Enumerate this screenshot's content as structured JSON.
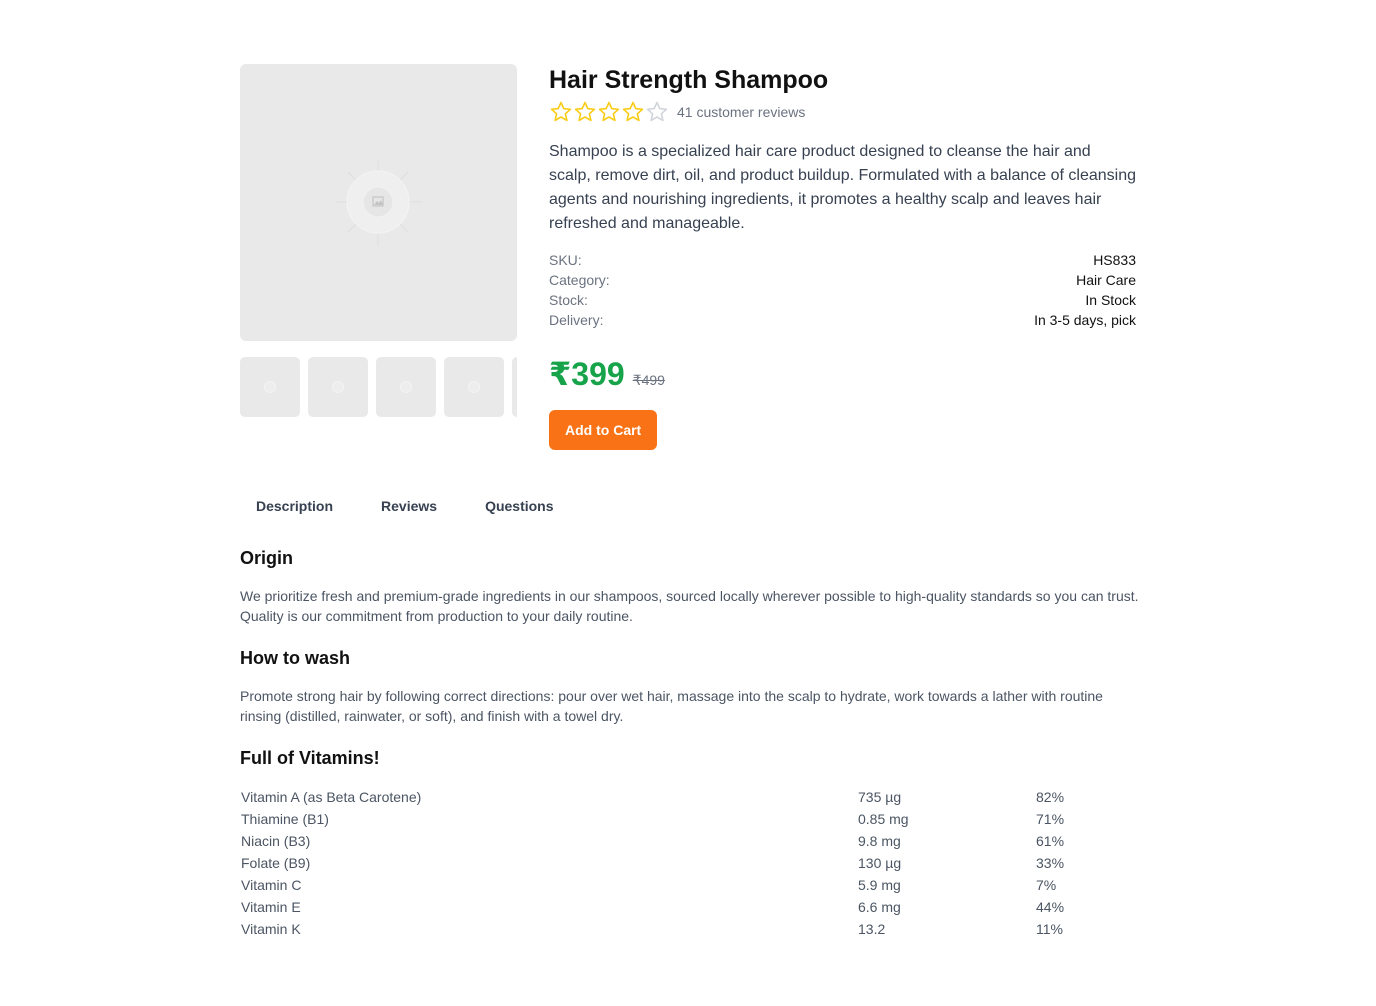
{
  "product": {
    "title": "Hair Strength Shampoo",
    "rating": 4,
    "rating_max": 5,
    "reviews_text": "41 customer reviews",
    "description": "Shampoo is a specialized hair care product designed to cleanse the hair and scalp, remove dirt, oil, and product buildup. Formulated with a balance of cleansing agents and nourishing ingredients, it promotes a healthy scalp and leaves hair refreshed and manageable.",
    "meta": [
      {
        "label": "SKU:",
        "value": "HS833"
      },
      {
        "label": "Category:",
        "value": "Hair Care"
      },
      {
        "label": "Stock:",
        "value": "In Stock"
      },
      {
        "label": "Delivery:",
        "value": "In 3-5 days, pick"
      }
    ],
    "price": "₹399",
    "old_price": "₹499",
    "add_to_cart_label": "Add to Cart"
  },
  "tabs": [
    {
      "label": "Description"
    },
    {
      "label": "Reviews"
    },
    {
      "label": "Questions"
    }
  ],
  "sections": {
    "origin": {
      "title": "Origin",
      "text": "We prioritize fresh and premium-grade ingredients in our shampoos, sourced locally wherever possible to high-quality standards so you can trust. Quality is our commitment from production to your daily routine."
    },
    "how_to_wash": {
      "title": "How to wash",
      "text": "Promote strong hair by following correct directions: pour over wet hair, massage into the scalp to hydrate, work towards a lather with routine rinsing (distilled, rainwater, or soft), and finish with a towel dry."
    },
    "vitamins": {
      "title": "Full of Vitamins!",
      "rows": [
        [
          "Vitamin A (as Beta Carotene)",
          "735 µg",
          "82%"
        ],
        [
          "Thiamine (B1)",
          "0.85 mg",
          "71%"
        ],
        [
          "Niacin (B3)",
          "9.8 mg",
          "61%"
        ],
        [
          "Folate (B9)",
          "130 µg",
          "33%"
        ],
        [
          "Vitamin C",
          "5.9 mg",
          "7%"
        ],
        [
          "Vitamin E",
          "6.6 mg",
          "44%"
        ],
        [
          "Vitamin K",
          "13.2",
          "11%"
        ]
      ]
    }
  },
  "colors": {
    "accent": "#f97316",
    "price": "#16a34a",
    "star_filled": "#facc15",
    "star_empty": "#d1d5db",
    "image_placeholder": "#e9e9e9"
  },
  "icons": {
    "main_image": "image-placeholder-icon",
    "thumbnail": "image-placeholder-icon",
    "star": "star-icon"
  }
}
